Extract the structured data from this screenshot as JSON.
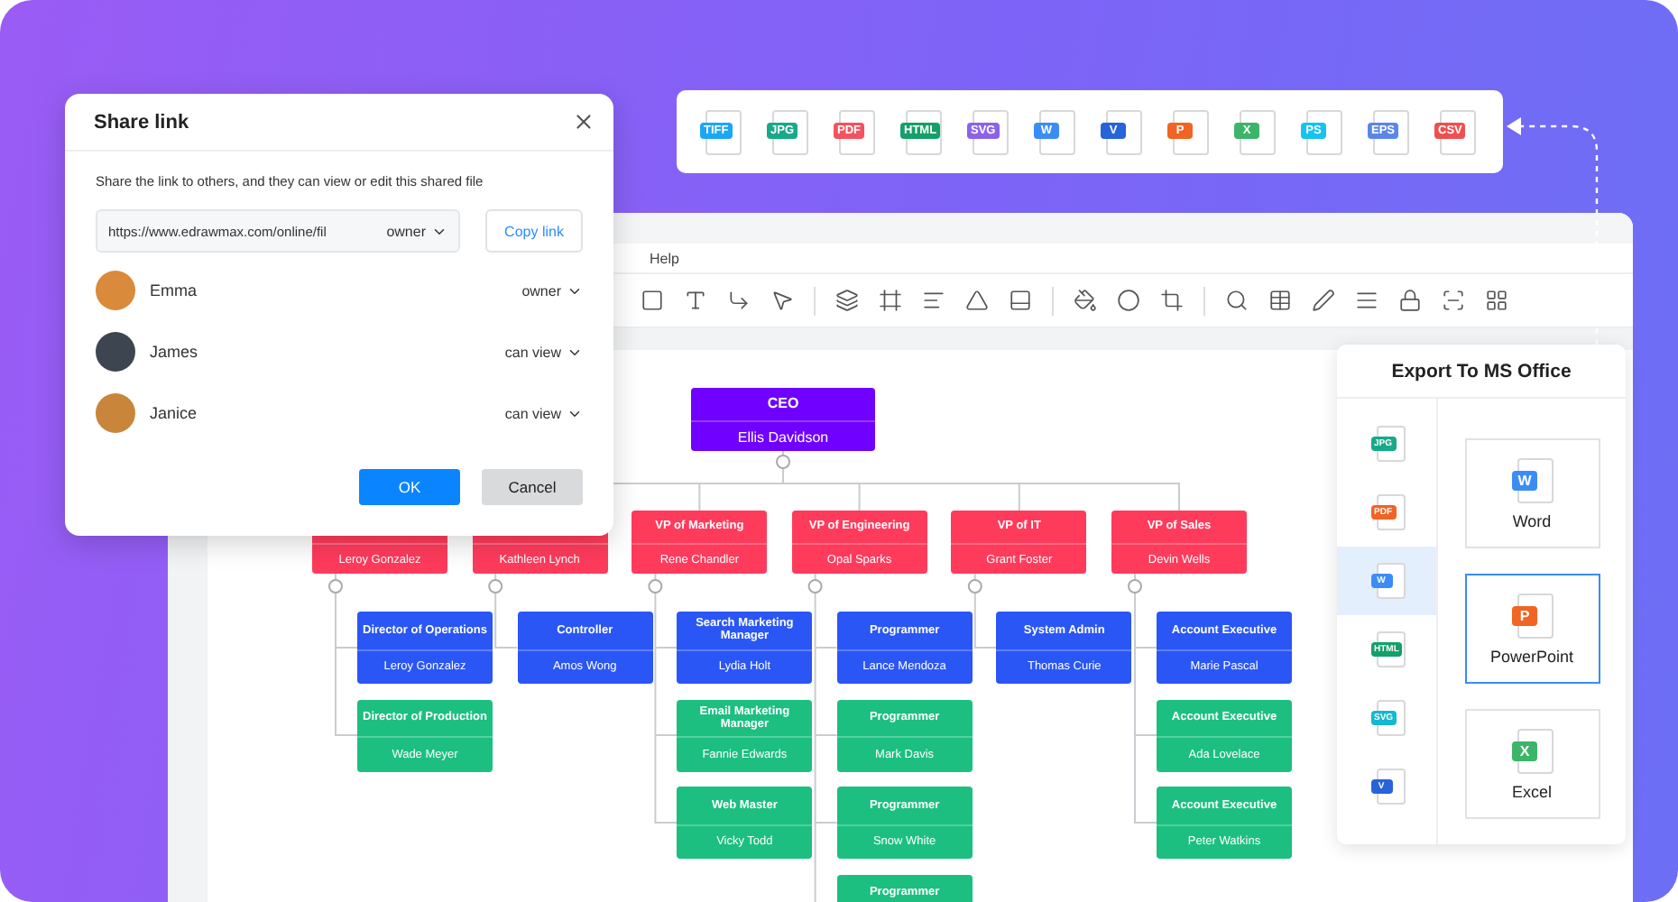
{
  "format_toolbar": {
    "formats": [
      {
        "label": "TIFF",
        "color": "#1aa7f5"
      },
      {
        "label": "JPG",
        "color": "#17a98a"
      },
      {
        "label": "PDF",
        "color": "#f4525f"
      },
      {
        "label": "HTML",
        "color": "#14a06a"
      },
      {
        "label": "SVG",
        "color": "#8a63e8"
      },
      {
        "label": "W",
        "color": "#3b8df5"
      },
      {
        "label": "V",
        "color": "#2763d9"
      },
      {
        "label": "P",
        "color": "#f06424"
      },
      {
        "label": "X",
        "color": "#3cb56a"
      },
      {
        "label": "PS",
        "color": "#14c3f0"
      },
      {
        "label": "EPS",
        "color": "#5b86e8"
      },
      {
        "label": "CSV",
        "color": "#f04f4f"
      }
    ]
  },
  "editor": {
    "menu": [
      "Help"
    ]
  },
  "org_chart": {
    "ceo": {
      "title": "CEO",
      "name": "Ellis Davidson"
    },
    "vps": [
      {
        "name": "Leroy Gonzalez",
        "children": [
          {
            "title": "Director of Operations",
            "name": "Leroy Gonzalez",
            "color": "#2a56f5"
          },
          {
            "title": "Director of Production",
            "name": "Wade Meyer",
            "color": "#1cbf80"
          }
        ]
      },
      {
        "name": "Kathleen Lynch",
        "children": [
          {
            "title": "Controller",
            "name": "Amos Wong",
            "color": "#2a56f5"
          }
        ]
      },
      {
        "title": "VP of Marketing",
        "name": "Rene Chandler",
        "children": [
          {
            "title": "Search Marketing Manager",
            "name": "Lydia Holt",
            "color": "#2a56f5"
          },
          {
            "title": "Email Marketing Manager",
            "name": "Fannie Edwards",
            "color": "#1cbf80"
          },
          {
            "title": "Web Master",
            "name": "Vicky Todd",
            "color": "#1cbf80"
          }
        ]
      },
      {
        "title": "VP of Engineering",
        "name": "Opal Sparks",
        "children": [
          {
            "title": "Programmer",
            "name": "Lance Mendoza",
            "color": "#2a56f5"
          },
          {
            "title": "Programmer",
            "name": "Mark Davis",
            "color": "#1cbf80"
          },
          {
            "title": "Programmer",
            "name": "Snow White",
            "color": "#1cbf80"
          },
          {
            "title": "Programmer",
            "color": "#1cbf80"
          }
        ]
      },
      {
        "title": "VP of IT",
        "name": "Grant Foster",
        "children": [
          {
            "title": "System Admin",
            "name": "Thomas Curie",
            "color": "#2a56f5"
          }
        ]
      },
      {
        "title": "VP of Sales",
        "name": "Devin Wells",
        "children": [
          {
            "title": "Account Executive",
            "name": "Marie Pascal",
            "color": "#2a56f5"
          },
          {
            "title": "Account Executive",
            "name": "Ada Lovelace",
            "color": "#1cbf80"
          },
          {
            "title": "Account Executive",
            "name": "Peter Watkins",
            "color": "#1cbf80"
          }
        ]
      }
    ]
  },
  "share_dialog": {
    "title": "Share link",
    "description": "Share the link to others, and they can view or edit this shared file",
    "link": {
      "value": "https://www.edrawmax.com/online/fil",
      "permission": "owner"
    },
    "copy_button": "Copy link",
    "people": [
      {
        "name": "Emma",
        "permission": "owner"
      },
      {
        "name": "James",
        "permission": "can view"
      },
      {
        "name": "Janice",
        "permission": "can view"
      }
    ],
    "ok": "OK",
    "cancel": "Cancel"
  },
  "export_panel": {
    "title": "Export To MS Office",
    "formats": [
      {
        "label": "JPG",
        "color": "#17a98a",
        "selected": false
      },
      {
        "label": "PDF",
        "color": "#f06424",
        "selected": false
      },
      {
        "label": "W",
        "color": "#3b8df5",
        "selected": true
      },
      {
        "label": "HTML",
        "color": "#14a06a",
        "selected": false
      },
      {
        "label": "SVG",
        "color": "#14b8d0",
        "selected": false
      },
      {
        "label": "V",
        "color": "#2763d9",
        "selected": false
      }
    ],
    "options": [
      {
        "label": "Word",
        "icon_label": "W",
        "color": "#3b8df5",
        "selected": false
      },
      {
        "label": "PowerPoint",
        "icon_label": "P",
        "color": "#f06424",
        "selected": true
      },
      {
        "label": "Excel",
        "icon_label": "X",
        "color": "#3cb56a",
        "selected": false
      }
    ]
  }
}
